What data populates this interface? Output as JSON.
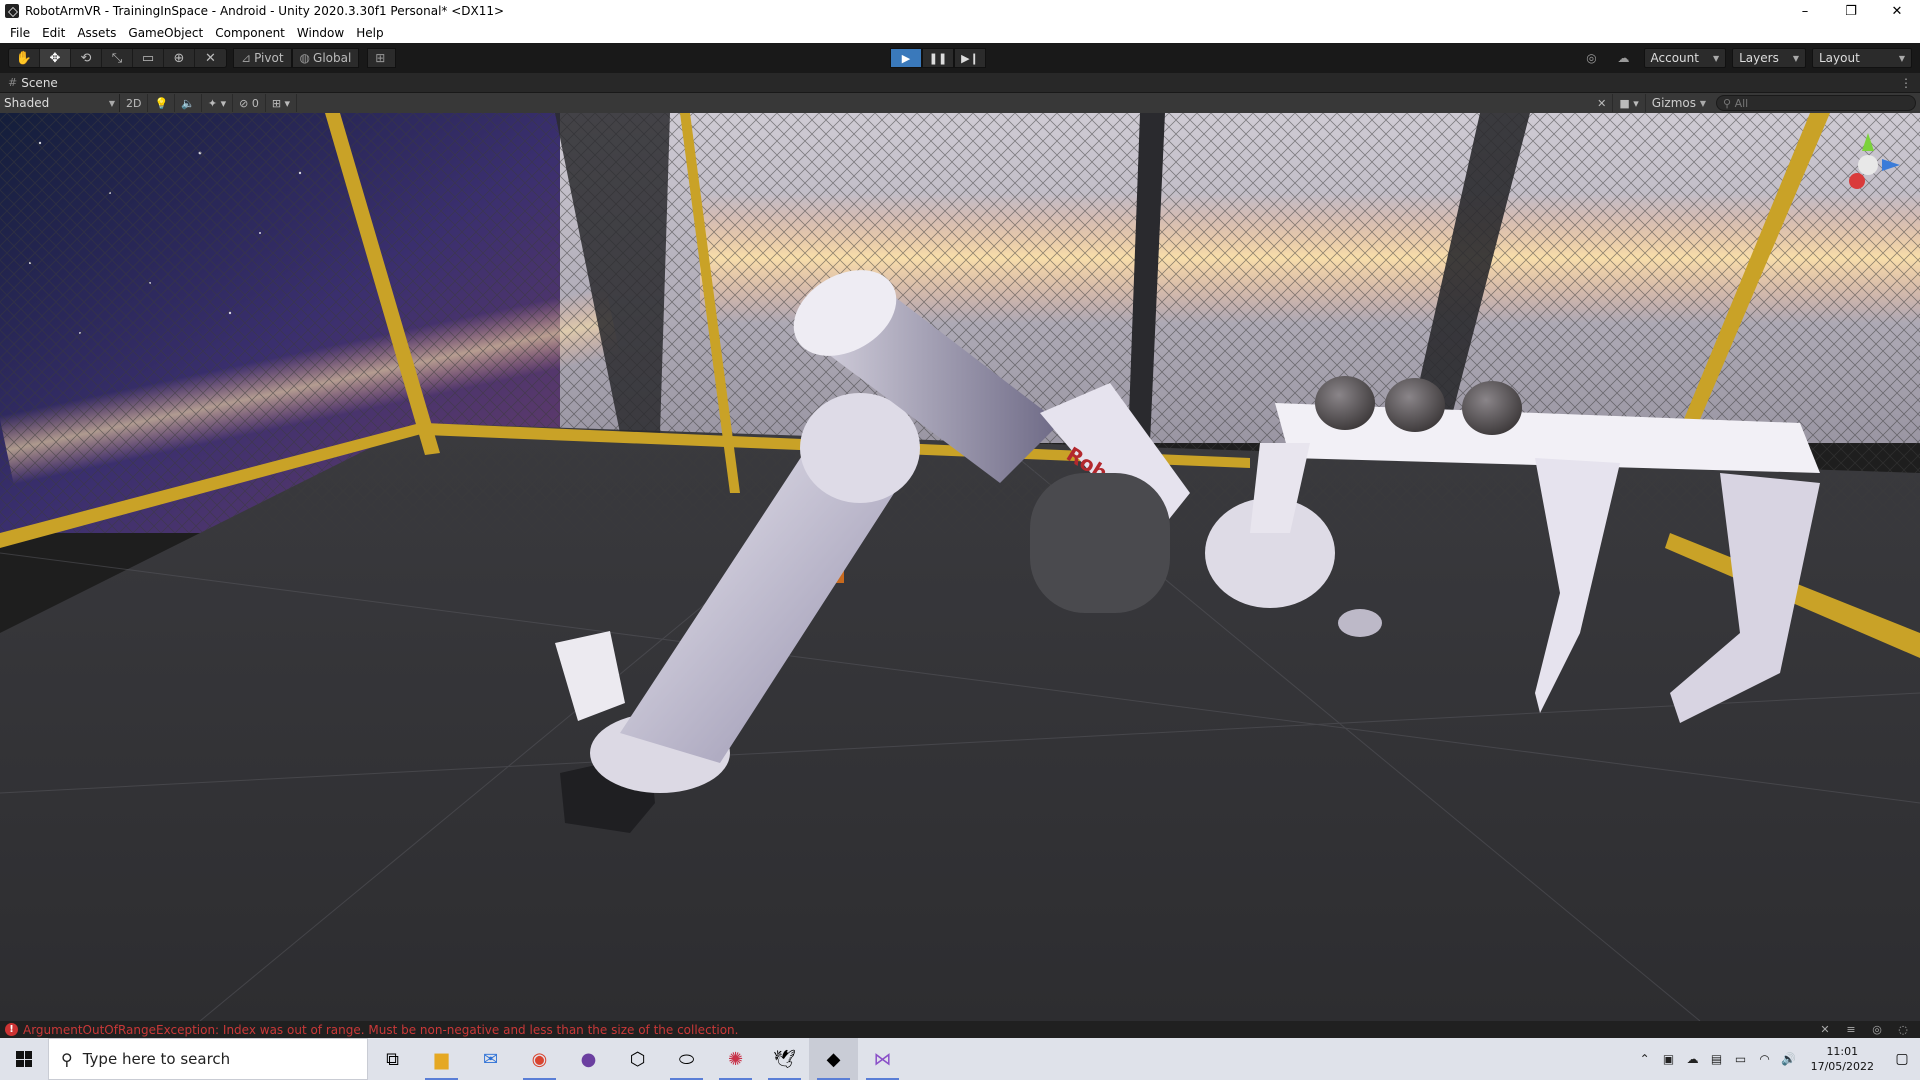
{
  "window": {
    "title": "RobotArmVR - TrainingInSpace - Android - Unity 2020.3.30f1 Personal* <DX11>",
    "controls": [
      "–",
      "❐",
      "✕"
    ]
  },
  "menu": [
    "File",
    "Edit",
    "Assets",
    "GameObject",
    "Component",
    "Window",
    "Help"
  ],
  "toolbar": {
    "tools": [
      "hand-tool",
      "move-tool",
      "rotate-tool",
      "scale-tool",
      "rect-tool",
      "transform-tool",
      "custom-tool"
    ],
    "pivot_label": "Pivot",
    "global_label": "Global",
    "account_label": "Account",
    "layers_label": "Layers",
    "layout_label": "Layout"
  },
  "scene": {
    "tab_label": "Scene",
    "shading_mode": "Shaded",
    "mode_2d": "2D",
    "hidden_count": "0",
    "gizmos_label": "Gizmos",
    "search_placeholder": "All",
    "robot_brand": "RobotLab"
  },
  "status": {
    "error_message": "ArgumentOutOfRangeException: Index was out of range. Must be non-negative and less than the size of the collection."
  },
  "taskbar": {
    "search_placeholder": "Type here to search",
    "apps": [
      "task-view",
      "file-explorer",
      "mail",
      "chrome",
      "github-desktop",
      "unity-hub",
      "oculus",
      "app-drone",
      "app-bird",
      "unity-editor",
      "visual-studio"
    ],
    "time": "11:01",
    "date": "17/05/2022"
  },
  "colors": {
    "play_active": "#3a79bb",
    "error_text": "#c93838",
    "cage_frame": "#c9a227"
  }
}
